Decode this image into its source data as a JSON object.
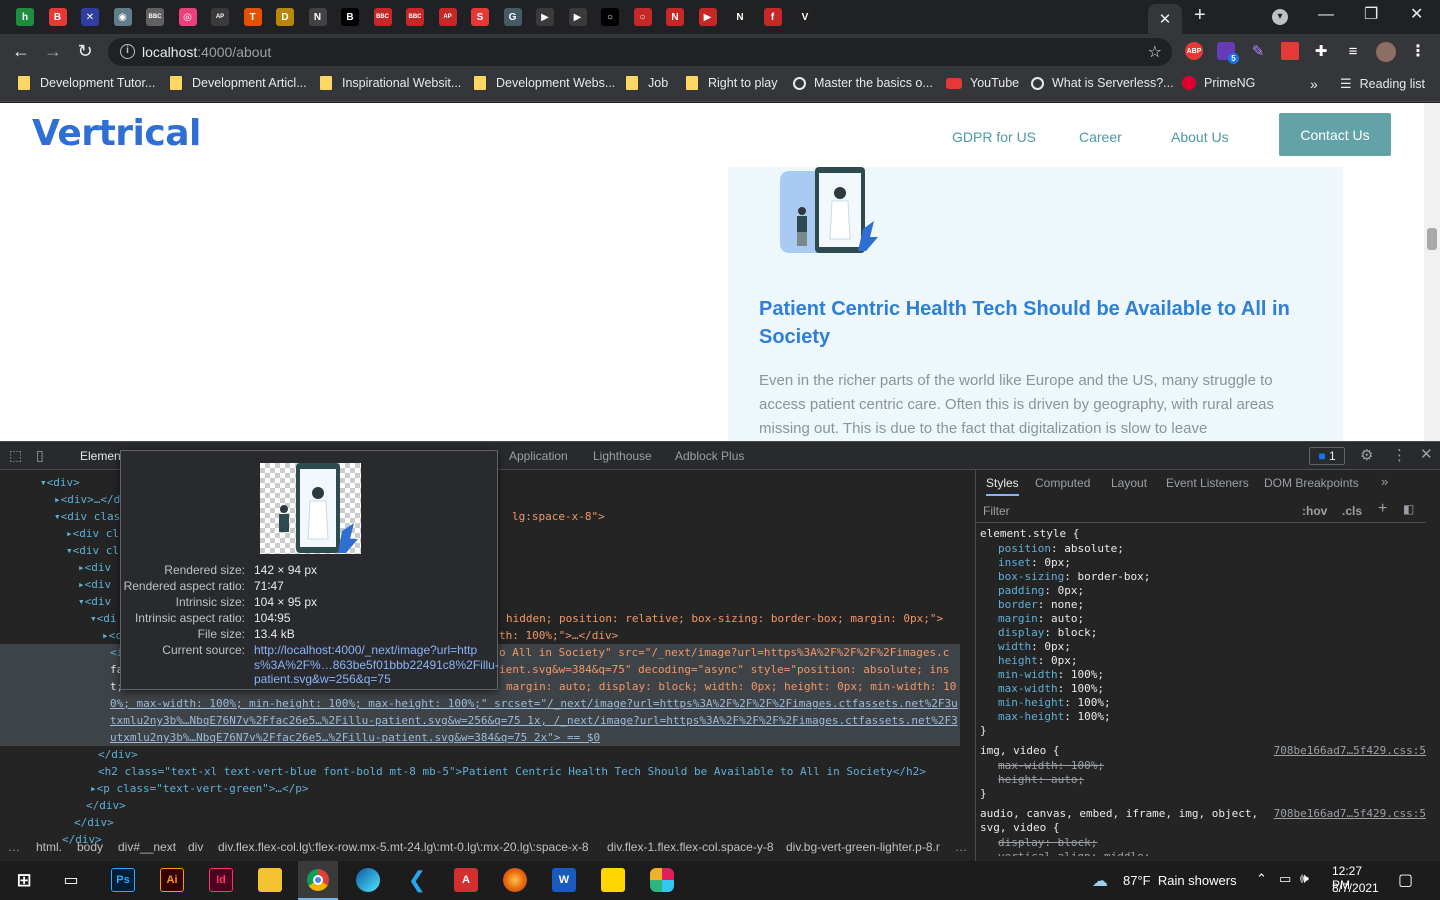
{
  "browser": {
    "url_host": "localhost",
    "url_path": ":4000/about",
    "reading_list": "Reading list",
    "tab_favicons": [
      "h",
      "B",
      "✕",
      "◉",
      "BBC",
      "◎",
      "AP",
      "T",
      "D",
      "N",
      "B",
      "BBC",
      "BBC",
      "AP",
      "S",
      "G",
      "▶",
      "▶",
      "○",
      "○",
      "N",
      "▶",
      "N",
      "f",
      "V"
    ],
    "ext_abp": "ABP",
    "ext_badge": "5"
  },
  "bookmarks": [
    {
      "label": "Development Tutor...",
      "type": "folder"
    },
    {
      "label": "Development Articl...",
      "type": "folder"
    },
    {
      "label": "Inspirational Websit...",
      "type": "folder"
    },
    {
      "label": "Development Webs...",
      "type": "folder"
    },
    {
      "label": "Job",
      "type": "folder"
    },
    {
      "label": "Right to play",
      "type": "folder"
    },
    {
      "label": "Master the basics o...",
      "type": "site"
    },
    {
      "label": "YouTube",
      "type": "youtube"
    },
    {
      "label": "What is Serverless?...",
      "type": "site"
    },
    {
      "label": "PrimeNG",
      "type": "prime"
    }
  ],
  "site": {
    "logo": "Vertrical",
    "nav": [
      "GDPR for US",
      "Career",
      "About Us"
    ],
    "contact": "Contact Us",
    "card_title": "Patient Centric Health Tech Should be Available to All in Society",
    "card_text": "Even in the richer parts of the world like Europe and the US, many struggle to access patient centric care. Often this is driven by geography, with rural areas missing out. This is due to the fact that digitalization is slow to leave"
  },
  "devtools": {
    "tabs": [
      "Elements",
      "Application",
      "Lighthouse",
      "Adblock Plus"
    ],
    "issues_count": "1",
    "style_tabs": [
      "Styles",
      "Computed",
      "Layout",
      "Event Listeners",
      "DOM Breakpoints"
    ],
    "filter_placeholder": "Filter",
    "hov": ":hov",
    "cls": ".cls",
    "dom_lines": [
      "▾<div>",
      "▸<div>…</d",
      "▾<div clas",
      "▸<div cl",
      "▾<div cl",
      "▸<div",
      "▸<div",
      "▾<div",
      "▾<di",
      "▸<c",
      "<i",
      "fa",
      "t;",
      "0%; max-width: 100%; min-height: 100%; max-height: 100%;\" srcset=\"/_next/image?url=https%3A%2F%2F%2F%2Fimages.ctfassets.net%2F3u",
      "txmlu2ny3b%…NbqE76N7v%2Ffac26e5…%2Fillu-patient.svg&w=256&q=75 1x, /_next/image?url=https%3A%2F%2F%2F%2Fimages.ctfassets.net%2F3",
      "utxmlu2ny3b%…NbqE76N7v%2Ffac26e5…%2Fillu-patient.svg&w=384&q=75 2x\"> == $0",
      "</div>",
      "<h2 class=\"text-xl text-vert-blue font-bold mt-8 mb-5\">Patient Centric Health Tech Should be Available to All in Society</h2>",
      "▸<p class=\"text-vert-green\">…</p>",
      "</div>",
      "</div>",
      "</div>"
    ],
    "dom_right": [
      "lg:space-x-8\">",
      "hidden; position: relative; box-sizing: border-box; margin: 0px;\">",
      "th: 100%;\">…</div>",
      "o All in Society\" src=\"/_next/image?url=https%3A%2F%2F%2F%2Fimages.ct",
      "ient.svg&w=384&q=75\" decoding=\"async\" style=\"position: absolute; inse",
      "margin: auto; display: block; width: 0px; height: 0px; min-width: 10"
    ],
    "breadcrumbs": [
      "…",
      "html.",
      "body",
      "div#__next",
      "div",
      "div.flex.flex-col.lg\\:flex-row.mx-5.mt-24.lg\\:mt-0.lg\\:mx-20.lg\\:space-x-8",
      "div.flex-1.flex.flex-col.space-y-8",
      "div.bg-vert-green-lighter.p-8.r",
      "…"
    ],
    "element_style": {
      "selector": "element.style {",
      "props": [
        [
          "position",
          "absolute"
        ],
        [
          "inset",
          "0px"
        ],
        [
          "box-sizing",
          "border-box"
        ],
        [
          "padding",
          "0px"
        ],
        [
          "border",
          "none"
        ],
        [
          "margin",
          "auto"
        ],
        [
          "display",
          "block"
        ],
        [
          "width",
          "0px"
        ],
        [
          "height",
          "0px"
        ],
        [
          "min-width",
          "100%"
        ],
        [
          "max-width",
          "100%"
        ],
        [
          "min-height",
          "100%"
        ],
        [
          "max-height",
          "100%"
        ]
      ]
    },
    "rule2": {
      "selector": "img, video {",
      "source": "708be166ad7…5f429.css:5",
      "props": [
        "max-width: 100%;",
        "height: auto;"
      ]
    },
    "rule3": {
      "selector": "audio, canvas, embed, iframe, img, object,",
      "selector2": "svg, video {",
      "source": "708be166ad7…5f429.css:5",
      "props": [
        "display: block;",
        "vertical-align: middle;"
      ]
    }
  },
  "tooltip": {
    "rows": [
      [
        "Rendered size:",
        "142 × 94 px"
      ],
      [
        "Rendered aspect ratio:",
        "71∶47"
      ],
      [
        "Intrinsic size:",
        "104 × 95 px"
      ],
      [
        "Intrinsic aspect ratio:",
        "104∶95"
      ],
      [
        "File size:",
        "13.4 kB"
      ],
      [
        "Current source:",
        "http://localhost:4000/_next/image?url=http"
      ]
    ],
    "source_line2": "s%3A%2F%…863be5f01bbb22491c8%2Fillu-",
    "source_line3": "patient.svg&w=256&q=75"
  },
  "taskbar": {
    "weather": "87°F  Rain showers",
    "time": "12:27 PM",
    "date": "8/7/2021",
    "apps": [
      "Ps",
      "Ai",
      "Id",
      "",
      "",
      "",
      "",
      "",
      "",
      "W",
      "",
      ""
    ]
  }
}
